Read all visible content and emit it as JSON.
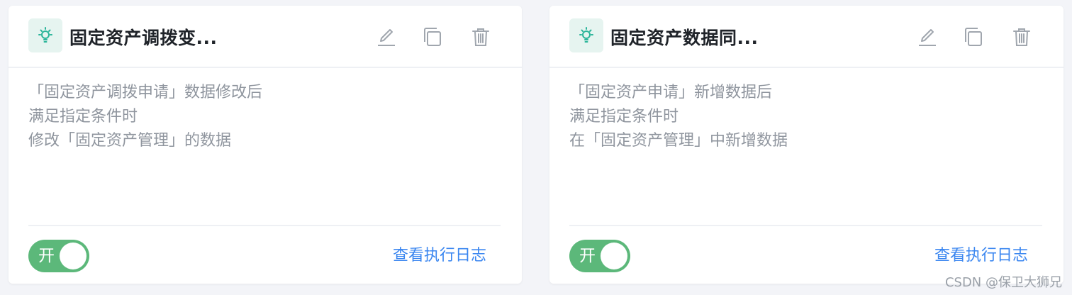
{
  "cards": [
    {
      "title": "固定资产调拨变...",
      "description": [
        "「固定资产调拨申请」数据修改后",
        "满足指定条件时",
        "修改「固定资产管理」的数据"
      ],
      "toggle_label": "开",
      "toggle_on": true,
      "log_link": "查看执行日志"
    },
    {
      "title": "固定资产数据同...",
      "description": [
        "「固定资产申请」新增数据后",
        "满足指定条件时",
        "在「固定资产管理」中新增数据"
      ],
      "toggle_label": "开",
      "toggle_on": true,
      "log_link": "查看执行日志"
    }
  ],
  "icons": {
    "rule": "lightbulb-icon",
    "edit": "pencil-icon",
    "copy": "copy-icon",
    "delete": "trash-icon"
  },
  "colors": {
    "toggle_on": "#5cb87a",
    "link": "#3a86f0",
    "icon_teal": "#2bb59a",
    "icon_bg": "#e6f4f0"
  },
  "watermark": "CSDN @保卫大狮兄"
}
